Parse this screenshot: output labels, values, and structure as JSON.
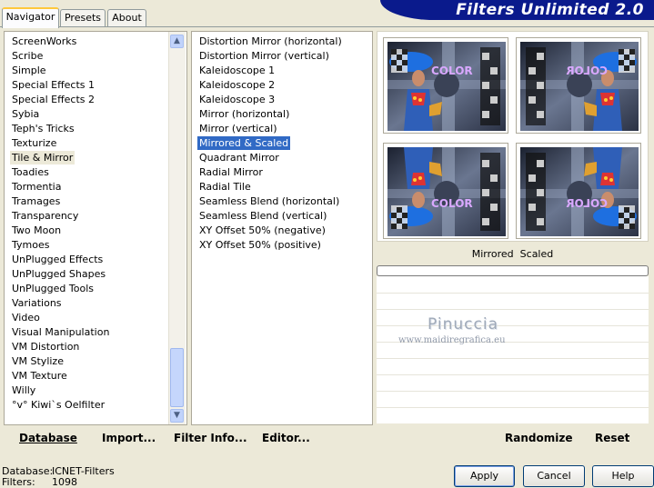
{
  "app": {
    "title": "Filters Unlimited 2.0",
    "tabs": [
      {
        "label": "Navigator"
      },
      {
        "label": "Presets"
      },
      {
        "label": "About"
      }
    ]
  },
  "categories": {
    "items": [
      "ScreenWorks",
      "Scribe",
      "Simple",
      "Special Effects 1",
      "Special Effects 2",
      "Sybia",
      "Teph's Tricks",
      "Texturize",
      "Tile & Mirror",
      "Toadies",
      "Tormentia",
      "Tramages",
      "Transparency",
      "Two Moon",
      "Tymoes",
      "UnPlugged Effects",
      "UnPlugged Shapes",
      "UnPlugged Tools",
      "Variations",
      "Video",
      "Visual Manipulation",
      "VM Distortion",
      "VM Stylize",
      "VM Texture",
      "Willy",
      "°v° Kiwi`s Oelfilter"
    ],
    "selected_index": 8
  },
  "filters": {
    "items": [
      "Distortion Mirror (horizontal)",
      "Distortion Mirror (vertical)",
      "Kaleidoscope 1",
      "Kaleidoscope 2",
      "Kaleidoscope 3",
      "Mirror (horizontal)",
      "Mirror (vertical)",
      "Mirrored & Scaled",
      "Quadrant Mirror",
      "Radial Mirror",
      "Radial Tile",
      "Seamless Blend (horizontal)",
      "Seamless Blend (vertical)",
      "XY Offset 50% (negative)",
      "XY Offset 50% (positive)"
    ],
    "selected_index": 7
  },
  "preview": {
    "filter_name": "Mirrored  Scaled",
    "progress": 0,
    "watermark_name": "Pinuccia",
    "watermark_url": "www.maidiregrafica.eu",
    "thumb_text": "COLOR"
  },
  "toolbar": {
    "database": "Database",
    "import": "Import...",
    "filter_info": "Filter Info...",
    "editor": "Editor...",
    "randomize": "Randomize",
    "reset": "Reset"
  },
  "status": {
    "database_label": "Database:",
    "database_value": "ICNET-Filters",
    "filters_label": "Filters:",
    "filters_value": "1098"
  },
  "buttons": {
    "apply": "Apply",
    "cancel": "Cancel",
    "help": "Help"
  },
  "colors": {
    "selection": "#316ac5",
    "banner": "#0a1a8c",
    "accent_tab": "#ffc83c"
  }
}
